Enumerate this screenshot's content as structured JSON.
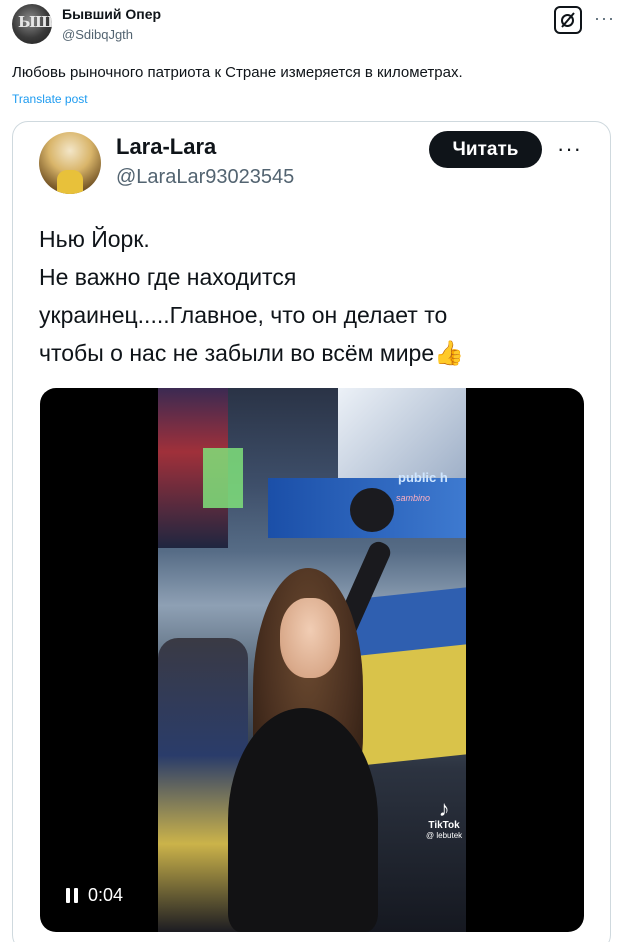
{
  "post": {
    "author_name": "Бывший Опер",
    "author_handle": "@SdibqJgth",
    "avatar_text": "ЫЩ",
    "text": "Любовь рыночного патриота к Стране измеряется в километрах.",
    "translate_label": "Translate post",
    "more_label": "···"
  },
  "quoted": {
    "author_name": "Lara-Lara",
    "author_handle": "@LaraLar93023545",
    "follow_label": "Читать",
    "more_label": "···",
    "text_lines": [
      "Нью Йорк.",
      "Не важно где находится",
      "украинец.....Главное, что он делает то",
      "чтобы о нас не забыли во всём мире"
    ],
    "emoji": "👍",
    "video": {
      "time": "0:04",
      "watermark_brand": "TikTok",
      "watermark_user": "@ lebutek",
      "billboard_text": "public h",
      "billboard_text_2": "sambino"
    }
  },
  "colors": {
    "text_primary": "#0f1419",
    "text_secondary": "#536471",
    "link": "#1d9bf0",
    "border": "#cfd9de"
  }
}
